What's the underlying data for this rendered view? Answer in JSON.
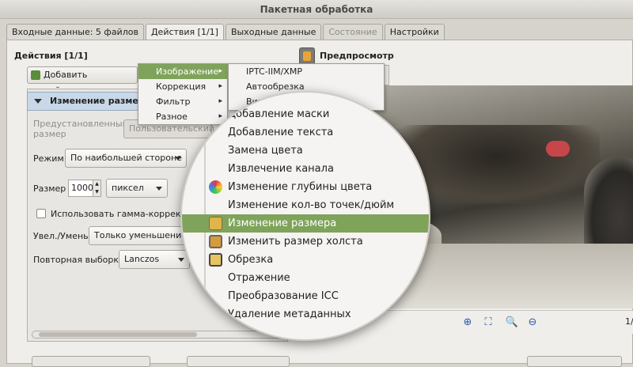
{
  "window": {
    "title": "Пакетная обработка"
  },
  "tabs": [
    {
      "label": "Входные данные: 5 файлов",
      "state": "normal"
    },
    {
      "label": "Действия [1/1]",
      "state": "active"
    },
    {
      "label": "Выходные данные",
      "state": "normal"
    },
    {
      "label": "Состояние",
      "state": "disabled"
    },
    {
      "label": "Настройки",
      "state": "normal"
    }
  ],
  "actions": {
    "section_title": "Действия [1/1]",
    "add_button": "Добавить действие>",
    "expander_title": "Изменение размера",
    "preset_label": "Предустановленный размер",
    "preset_value": "Пользовательский",
    "mode_label": "Режим",
    "mode_value": "По наибольшей стороне",
    "size_label": "Размер",
    "size_value": "1000",
    "unit_value": "пиксел",
    "gamma_label": "Использовать гамма-коррекцию",
    "zoom_label": "Увел./Умень.",
    "zoom_value": "Только уменьшение",
    "resample_label": "Повторная выборка",
    "resample_value": "Lanczos"
  },
  "preview": {
    "title": "Предпросмотр",
    "page_indicator": "1/"
  },
  "menu_main": [
    {
      "label": "Изображение",
      "selected": true
    },
    {
      "label": "Коррекция",
      "selected": false
    },
    {
      "label": "Фильтр",
      "selected": false
    },
    {
      "label": "Разное",
      "selected": false
    }
  ],
  "menu_sub_visible": [
    {
      "label": "IPTC-IIM/XMP"
    },
    {
      "label": "Автообрезка"
    },
    {
      "label": "Виньетирование"
    }
  ],
  "magnifier_items": [
    {
      "label": "Добавление маски",
      "icon": "mask-icon",
      "selected": false
    },
    {
      "label": "Добавление текста",
      "icon": "",
      "selected": false
    },
    {
      "label": "Замена цвета",
      "icon": "",
      "selected": false
    },
    {
      "label": "Извлечение канала",
      "icon": "",
      "selected": false
    },
    {
      "label": "Изменение глубины цвета",
      "icon": "color-depth-icon",
      "selected": false
    },
    {
      "label": "Изменение кол-во точек/дюйм",
      "icon": "",
      "selected": false
    },
    {
      "label": "Изменение размера",
      "icon": "resize-icon",
      "selected": true
    },
    {
      "label": "Изменить размер холста",
      "icon": "canvas-size-icon",
      "selected": false
    },
    {
      "label": "Обрезка",
      "icon": "crop-icon",
      "selected": false
    },
    {
      "label": "Отражение",
      "icon": "",
      "selected": false
    },
    {
      "label": "Преобразование ICC",
      "icon": "",
      "selected": false
    },
    {
      "label": "Удаление метаданных",
      "icon": "",
      "selected": false
    }
  ],
  "colors": {
    "selection": "#7fa35a",
    "accent_blue": "#2a5caa"
  }
}
